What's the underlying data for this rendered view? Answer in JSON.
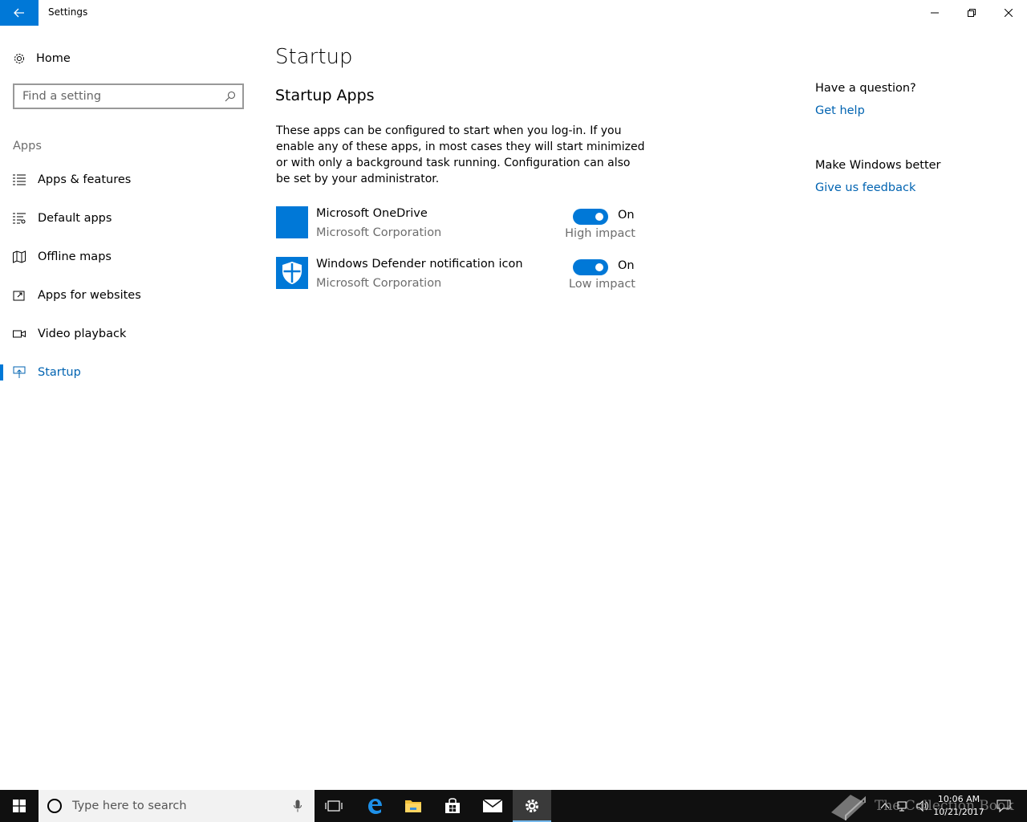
{
  "window": {
    "title": "Settings"
  },
  "sidebar": {
    "home_label": "Home",
    "search_placeholder": "Find a setting",
    "section_label": "Apps",
    "items": [
      {
        "label": "Apps & features",
        "icon": "list-icon"
      },
      {
        "label": "Default apps",
        "icon": "default-apps-icon"
      },
      {
        "label": "Offline maps",
        "icon": "map-icon"
      },
      {
        "label": "Apps for websites",
        "icon": "link-box-icon"
      },
      {
        "label": "Video playback",
        "icon": "video-icon"
      },
      {
        "label": "Startup",
        "icon": "startup-icon",
        "active": true
      }
    ]
  },
  "main": {
    "title": "Startup",
    "subtitle": "Startup Apps",
    "description": "These apps can be configured to start when you log-in. If you enable any of these apps, in most cases they will start minimized or with only a background task running. Configuration can also be set by your administrator.",
    "apps": [
      {
        "name": "Microsoft OneDrive",
        "publisher": "Microsoft Corporation",
        "state": "On",
        "impact": "High impact",
        "icon": "onedrive-icon"
      },
      {
        "name": "Windows Defender notification icon",
        "publisher": "Microsoft Corporation",
        "state": "On",
        "impact": "Low impact",
        "icon": "shield-icon"
      }
    ]
  },
  "right_panel": {
    "question_heading": "Have a question?",
    "help_link": "Get help",
    "feedback_heading": "Make Windows better",
    "feedback_link": "Give us feedback"
  },
  "taskbar": {
    "search_placeholder": "Type here to search",
    "time": "10:06 AM",
    "date": "10/21/2017",
    "watermark": "The Collection Book"
  },
  "colors": {
    "accent": "#0078d7",
    "link": "#0063b1",
    "taskbar": "#101010"
  }
}
